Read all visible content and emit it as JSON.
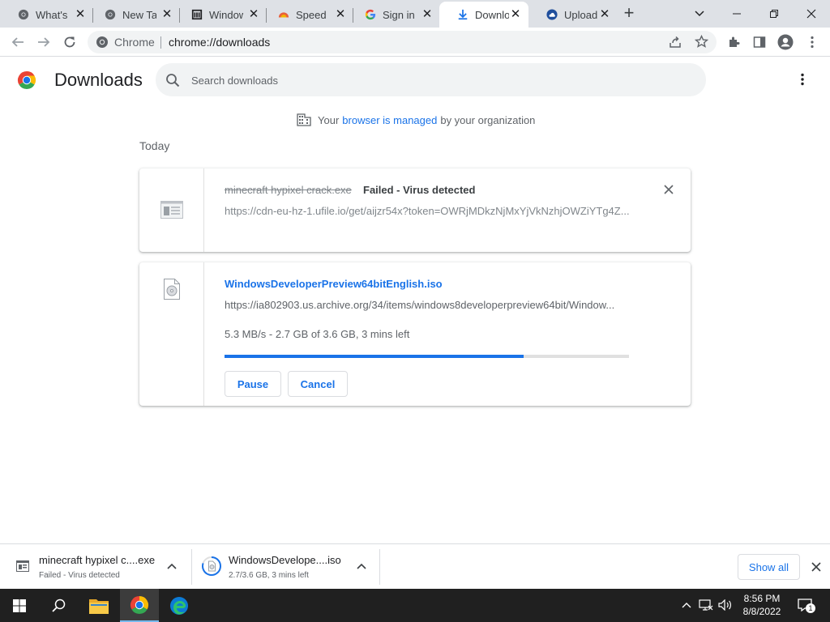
{
  "tabs": [
    {
      "title": "What's New",
      "icon": "chrome-icon"
    },
    {
      "title": "New Tab",
      "icon": "chrome-icon"
    },
    {
      "title": "Windows",
      "icon": "archive-icon"
    },
    {
      "title": "Speed Dial",
      "icon": "speed-icon"
    },
    {
      "title": "Sign in",
      "icon": "google-icon"
    },
    {
      "title": "Downloads",
      "icon": "download-icon"
    },
    {
      "title": "Upload",
      "icon": "upload-icon"
    }
  ],
  "toolbar": {
    "omni_label": "Chrome",
    "url": "chrome://downloads"
  },
  "page": {
    "title": "Downloads",
    "search_placeholder": "Search downloads",
    "managed_prefix": "Your",
    "managed_link": "browser is managed",
    "managed_suffix": "by your organization",
    "section": "Today"
  },
  "downloads": [
    {
      "filename": "minecraft hypixel crack.exe",
      "status": "Failed - Virus detected",
      "url": "https://cdn-eu-hz-1.ufile.io/get/aijzr54x?token=OWRjMDkzNjMxYjVkNzhjOWZiYTg4Z..."
    },
    {
      "filename": "WindowsDeveloperPreview64bitEnglish.iso",
      "url": "https://ia802903.us.archive.org/34/items/windows8developerpreview64bit/Window...",
      "progress_text": "5.3 MB/s - 2.7 GB of 3.6 GB, 3 mins left",
      "progress_fraction": 0.74,
      "pause_label": "Pause",
      "cancel_label": "Cancel"
    }
  ],
  "shelf": {
    "items": [
      {
        "name": "minecraft hypixel c....exe",
        "status": "Failed - Virus detected"
      },
      {
        "name": "WindowsDevelope....iso",
        "status": "2.7/3.6 GB, 3 mins left"
      }
    ],
    "show_all": "Show all"
  },
  "taskbar": {
    "time": "8:56 PM",
    "date": "8/8/2022",
    "notification_count": "1"
  },
  "colors": {
    "accent": "#1a73e8",
    "taskbar": "#202020",
    "tabstrip": "#dee1e6"
  }
}
